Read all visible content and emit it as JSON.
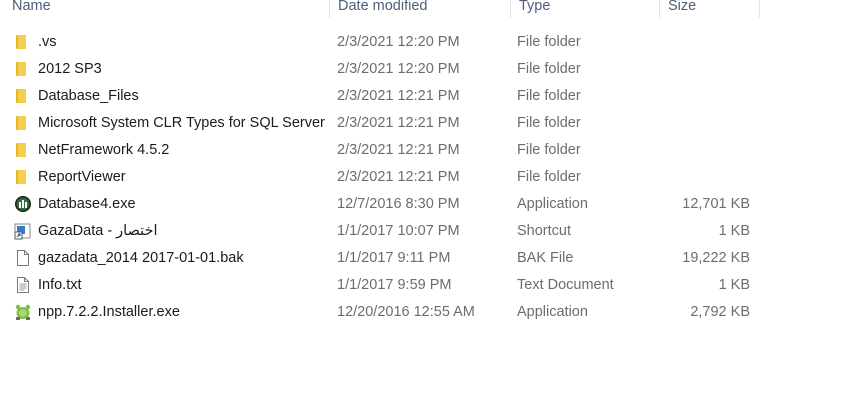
{
  "columns": {
    "name": "Name",
    "date_modified": "Date modified",
    "type": "Type",
    "size": "Size"
  },
  "files": [
    {
      "name": ".vs",
      "date": "2/3/2021 12:20 PM",
      "type": "File folder",
      "size": "",
      "icon": "folder-icon"
    },
    {
      "name": "2012 SP3",
      "date": "2/3/2021 12:20 PM",
      "type": "File folder",
      "size": "",
      "icon": "folder-icon"
    },
    {
      "name": "Database_Files",
      "date": "2/3/2021 12:21 PM",
      "type": "File folder",
      "size": "",
      "icon": "folder-icon"
    },
    {
      "name": "Microsoft System CLR Types for SQL Server",
      "date": "2/3/2021 12:21 PM",
      "type": "File folder",
      "size": "",
      "icon": "folder-icon"
    },
    {
      "name": "NetFramework 4.5.2",
      "date": "2/3/2021 12:21 PM",
      "type": "File folder",
      "size": "",
      "icon": "folder-icon"
    },
    {
      "name": "ReportViewer",
      "date": "2/3/2021 12:21 PM",
      "type": "File folder",
      "size": "",
      "icon": "folder-icon"
    },
    {
      "name": "Database4.exe",
      "date": "12/7/2016 8:30 PM",
      "type": "Application",
      "size": "12,701 KB",
      "icon": "database-app-icon"
    },
    {
      "name": "GazaData - اختصار",
      "date": "1/1/2017 10:07 PM",
      "type": "Shortcut",
      "size": "1 KB",
      "icon": "shortcut-icon"
    },
    {
      "name": "gazadata_2014 2017-01-01.bak",
      "date": "1/1/2017 9:11 PM",
      "type": "BAK File",
      "size": "19,222 KB",
      "icon": "blank-file-icon"
    },
    {
      "name": "Info.txt",
      "date": "1/1/2017 9:59 PM",
      "type": "Text Document",
      "size": "1 KB",
      "icon": "text-file-icon"
    },
    {
      "name": "npp.7.2.2.Installer.exe",
      "date": "12/20/2016 12:55 AM",
      "type": "Application",
      "size": "2,792 KB",
      "icon": "notepadpp-installer-icon"
    }
  ]
}
